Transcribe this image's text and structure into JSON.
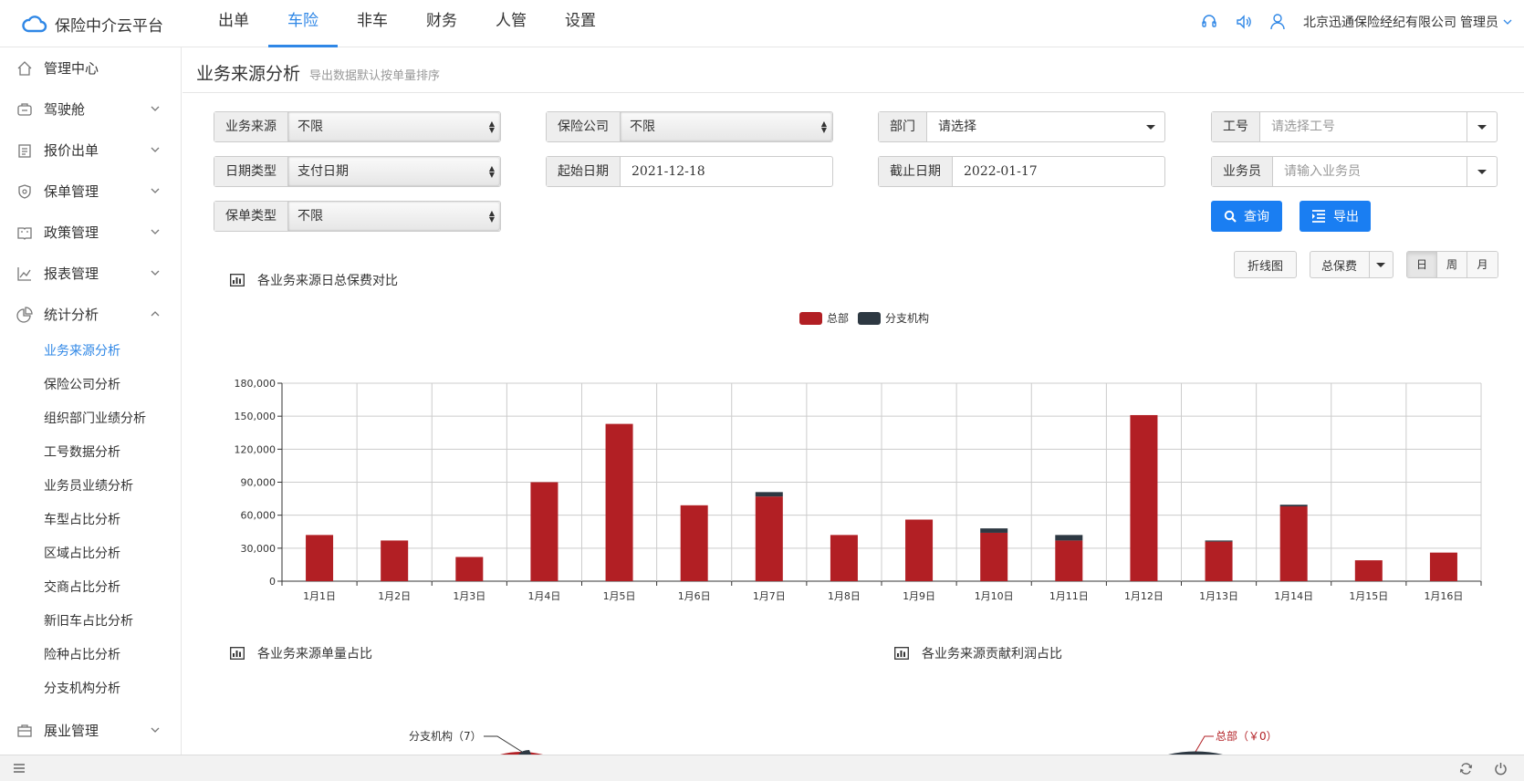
{
  "app": {
    "title": "保险中介云平台"
  },
  "topnav": [
    "出单",
    "车险",
    "非车",
    "财务",
    "人管",
    "设置"
  ],
  "user": {
    "org": "北京迅通保险经纪有限公司",
    "name": "管理员"
  },
  "sidebar": {
    "items": [
      {
        "label": "管理中心",
        "icon": "home-icon"
      },
      {
        "label": "驾驶舱",
        "icon": "dashboard-icon"
      },
      {
        "label": "报价出单",
        "icon": "clipboard-icon"
      },
      {
        "label": "保单管理",
        "icon": "shield-icon"
      },
      {
        "label": "政策管理",
        "icon": "book-icon"
      },
      {
        "label": "报表管理",
        "icon": "line-chart-icon"
      },
      {
        "label": "统计分析",
        "icon": "pie-chart-icon"
      }
    ],
    "subitems": [
      "业务来源分析",
      "保险公司分析",
      "组织部门业绩分析",
      "工号数据分析",
      "业务员业绩分析",
      "车型占比分析",
      "区域占比分析",
      "交商占比分析",
      "新旧车占比分析",
      "险种占比分析",
      "分支机构分析"
    ],
    "last": {
      "label": "展业管理",
      "icon": "briefcase-icon"
    }
  },
  "page": {
    "title": "业务来源分析",
    "subtitle": "导出数据默认按单量排序"
  },
  "filters": {
    "source": {
      "label": "业务来源",
      "value": "不限"
    },
    "insurer": {
      "label": "保险公司",
      "value": "不限"
    },
    "dept": {
      "label": "部门",
      "value": "请选择"
    },
    "job_no": {
      "label": "工号",
      "placeholder": "请选择工号"
    },
    "date_type": {
      "label": "日期类型",
      "value": "支付日期"
    },
    "start_date": {
      "label": "起始日期",
      "value": "2021-12-18"
    },
    "end_date": {
      "label": "截止日期",
      "value": "2022-01-17"
    },
    "salesman": {
      "label": "业务员",
      "placeholder": "请输入业务员"
    },
    "policy_type": {
      "label": "保单类型",
      "value": "不限"
    }
  },
  "buttons": {
    "query": "查询",
    "export": "导出"
  },
  "panels": {
    "daily": "各业务来源日总保费对比",
    "count": "各业务来源单量占比",
    "profit": "各业务来源贡献利润占比"
  },
  "controls": {
    "chart_type": "折线图",
    "metric": "总保费",
    "periods": [
      "日",
      "周",
      "月"
    ]
  },
  "pie_labels": {
    "count": "分支机构（7）",
    "profit": "总部（￥0）"
  },
  "colors": {
    "hq": "#b21f24",
    "branch": "#2d3842",
    "accent": "#2f87e6"
  },
  "chart_data": {
    "type": "bar",
    "stacked": true,
    "categories": [
      "1月1日",
      "1月2日",
      "1月3日",
      "1月4日",
      "1月5日",
      "1月6日",
      "1月7日",
      "1月8日",
      "1月9日",
      "1月10日",
      "1月11日",
      "1月12日",
      "1月13日",
      "1月14日",
      "1月15日",
      "1月16日"
    ],
    "series": [
      {
        "name": "总部",
        "color": "#b21f24",
        "values": [
          42000,
          37000,
          22000,
          90000,
          143000,
          69000,
          77000,
          42000,
          56000,
          44000,
          37000,
          151000,
          36000,
          68000,
          19000,
          26000
        ]
      },
      {
        "name": "分支机构",
        "color": "#2d3842",
        "values": [
          0,
          0,
          0,
          0,
          0,
          0,
          4000,
          0,
          0,
          4000,
          5000,
          0,
          1000,
          1500,
          0,
          0
        ]
      }
    ],
    "ylim": [
      0,
      180000
    ],
    "yticks": [
      "0",
      "30,000",
      "60,000",
      "90,000",
      "120,000",
      "150,000",
      "180,000"
    ],
    "grid": true,
    "legend": "top-center"
  }
}
